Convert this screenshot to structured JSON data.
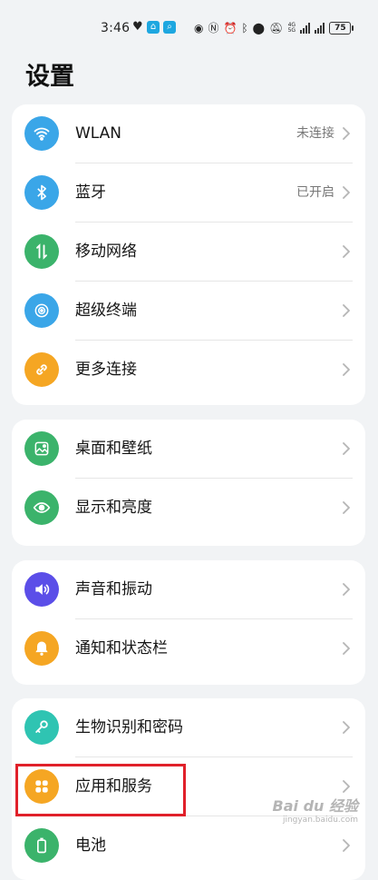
{
  "status_bar": {
    "time": "3:46",
    "battery": "75",
    "net_top": "4G",
    "net_bottom": "5G"
  },
  "page": {
    "title": "设置"
  },
  "groups": [
    {
      "items": [
        {
          "label": "WLAN",
          "value": "未连接",
          "icon": "wifi-icon",
          "color": "#3aa6e8"
        },
        {
          "label": "蓝牙",
          "value": "已开启",
          "icon": "bluetooth-icon",
          "color": "#3aa6e8"
        },
        {
          "label": "移动网络",
          "value": "",
          "icon": "mobile-data-icon",
          "color": "#3bb36b"
        },
        {
          "label": "超级终端",
          "value": "",
          "icon": "super-device-icon",
          "color": "#3aa6e8"
        },
        {
          "label": "更多连接",
          "value": "",
          "icon": "link-icon",
          "color": "#f5a623"
        }
      ]
    },
    {
      "items": [
        {
          "label": "桌面和壁纸",
          "value": "",
          "icon": "wallpaper-icon",
          "color": "#3bb36b"
        },
        {
          "label": "显示和亮度",
          "value": "",
          "icon": "eye-icon",
          "color": "#3bb36b"
        }
      ]
    },
    {
      "items": [
        {
          "label": "声音和振动",
          "value": "",
          "icon": "speaker-icon",
          "color": "#5b4ee8"
        },
        {
          "label": "通知和状态栏",
          "value": "",
          "icon": "bell-icon",
          "color": "#f5a623"
        }
      ]
    },
    {
      "items": [
        {
          "label": "生物识别和密码",
          "value": "",
          "icon": "key-icon",
          "color": "#2fc4b2"
        },
        {
          "label": "应用和服务",
          "value": "",
          "icon": "apps-icon",
          "color": "#f5a623"
        },
        {
          "label": "电池",
          "value": "",
          "icon": "battery-icon",
          "color": "#3bb36b"
        }
      ]
    }
  ],
  "watermark": {
    "text": "Bai du 经验",
    "sub": "jingyan.baidu.com"
  }
}
